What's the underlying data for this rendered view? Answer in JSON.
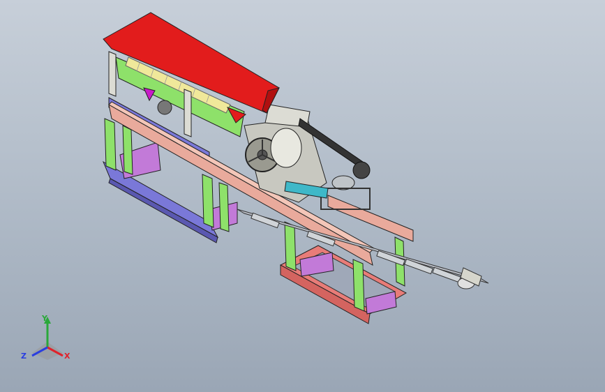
{
  "viewport": {
    "background_top": "#c7cfd9",
    "background_bottom": "#9aa6b5"
  },
  "triad": {
    "y_label": "Y",
    "z_label": "Z",
    "x_label": "X",
    "x_color": "#e0222b",
    "y_color": "#2aa83a",
    "z_color": "#2a3ee0"
  },
  "model": {
    "hopper_color": "#e21c1c",
    "frame_green": "#8ee16a",
    "beam_pink": "#e9aa9c",
    "base_blue": "#7a78d8",
    "base_red": "#e87c78",
    "brace_purple": "#c27ad8",
    "housing_grey": "#c8c8c0"
  }
}
